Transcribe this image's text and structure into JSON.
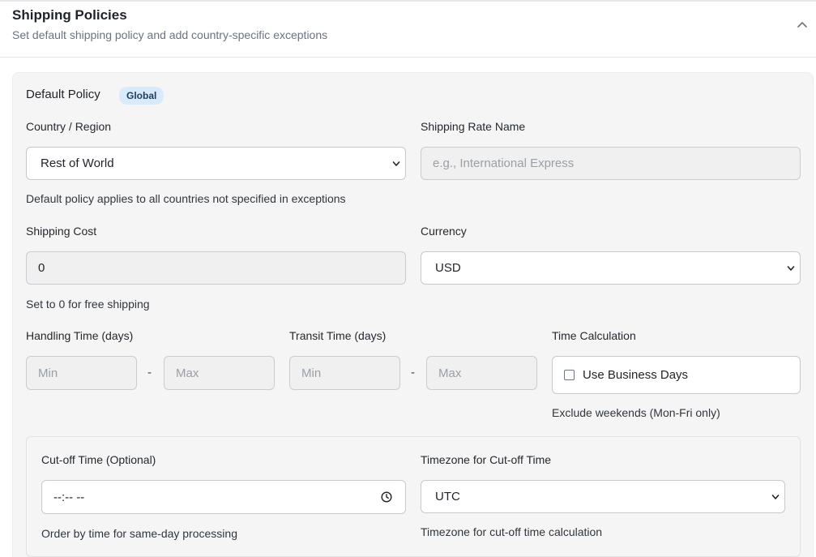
{
  "header": {
    "title": "Shipping Policies",
    "subtitle": "Set default shipping policy and add country-specific exceptions",
    "collapse_icon": "chevron-up-icon"
  },
  "default_policy": {
    "title": "Default Policy",
    "badge": "Global",
    "country": {
      "label": "Country / Region",
      "value": "Rest of World",
      "helper": "Default policy applies to all countries not specified in exceptions"
    },
    "rate_name": {
      "label": "Shipping Rate Name",
      "value": "",
      "placeholder": "e.g., International Express"
    },
    "cost": {
      "label": "Shipping Cost",
      "value": "0",
      "helper": "Set to 0 for free shipping"
    },
    "currency": {
      "label": "Currency",
      "value": "USD"
    },
    "handling": {
      "label": "Handling Time (days)",
      "min_placeholder": "Min",
      "max_placeholder": "Max",
      "separator": "-"
    },
    "transit": {
      "label": "Transit Time (days)",
      "min_placeholder": "Min",
      "max_placeholder": "Max",
      "separator": "-"
    },
    "time_calc": {
      "label": "Time Calculation",
      "checkbox_label": "Use Business Days",
      "checked": false,
      "helper": "Exclude weekends (Mon-Fri only)"
    },
    "cutoff": {
      "label": "Cut-off Time (Optional)",
      "value": "--:-- --",
      "helper": "Order by time for same-day processing"
    },
    "timezone": {
      "label": "Timezone for Cut-off Time",
      "value": "UTC",
      "helper": "Timezone for cut-off time calculation"
    }
  }
}
